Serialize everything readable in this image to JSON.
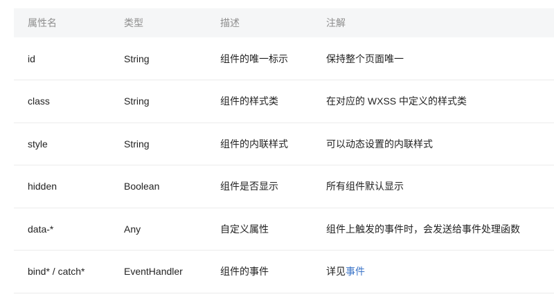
{
  "headers": [
    "属性名",
    "类型",
    "描述",
    "注解"
  ],
  "rows": [
    {
      "name": "id",
      "type": "String",
      "desc": "组件的唯一标示",
      "note": "保持整个页面唯一",
      "note_link": ""
    },
    {
      "name": "class",
      "type": "String",
      "desc": "组件的样式类",
      "note": "在对应的 WXSS 中定义的样式类",
      "note_link": ""
    },
    {
      "name": "style",
      "type": "String",
      "desc": "组件的内联样式",
      "note": "可以动态设置的内联样式",
      "note_link": ""
    },
    {
      "name": "hidden",
      "type": "Boolean",
      "desc": "组件是否显示",
      "note": "所有组件默认显示",
      "note_link": ""
    },
    {
      "name": "data-*",
      "type": "Any",
      "desc": "自定义属性",
      "note": "组件上触发的事件时，会发送给事件处理函数",
      "note_link": ""
    },
    {
      "name": "bind* / catch*",
      "type": "EventHandler",
      "desc": "组件的事件",
      "note": "详见",
      "note_link": "事件"
    }
  ],
  "colors": {
    "header_bg": "#f5f6f7",
    "header_text": "#8e8e8e",
    "link": "#3c75c8",
    "border": "#ebebeb"
  }
}
